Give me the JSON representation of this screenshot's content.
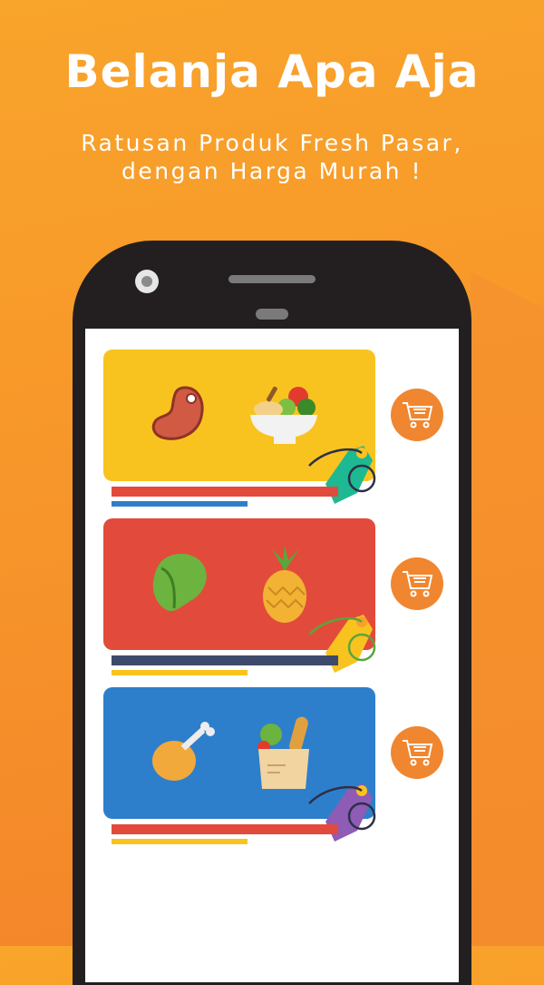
{
  "header": {
    "title": "Belanja Apa Aja",
    "subtitle_line1": "Ratusan Produk Fresh Pasar,",
    "subtitle_line2": "dengan Harga Murah !"
  },
  "colors": {
    "background": "#F7952A",
    "cart": "#F0862F",
    "card_yellow": "#F9C31F",
    "card_red": "#E24B3B",
    "card_blue": "#2E7FCB"
  },
  "cards": [
    {
      "color": "#F9C31F",
      "icons": [
        "meat-icon",
        "salad-bowl-icon"
      ],
      "tag_color": "#1DB992",
      "bar1": "#E24B3B",
      "bar2": "#2E7FCB"
    },
    {
      "color": "#E24B3B",
      "icons": [
        "lettuce-icon",
        "pineapple-icon"
      ],
      "tag_color": "#F9C31F",
      "bar1": "#3E4A6B",
      "bar2": "#F9C31F"
    },
    {
      "color": "#2E7FCB",
      "icons": [
        "chicken-leg-icon",
        "grocery-bag-icon"
      ],
      "tag_color": "#8E5BB5",
      "bar1": "#E24B3B",
      "bar2": "#F9C31F"
    }
  ]
}
